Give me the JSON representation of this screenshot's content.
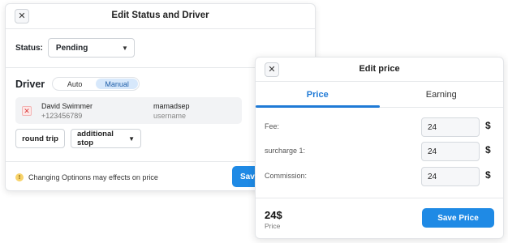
{
  "status_modal": {
    "title": "Edit Status and Driver",
    "close_icon": "close-icon",
    "status": {
      "label": "Status:",
      "value": "Pending"
    },
    "driver": {
      "title": "Driver",
      "modes": [
        "Auto",
        "Manual"
      ],
      "active_mode": "Manual",
      "card": {
        "name": "David Swimmer",
        "phone": "+123456789",
        "username": "mamadsep",
        "username_label": "username"
      }
    },
    "chips": {
      "round_trip": "round trip",
      "additional_stop": "additional stop"
    },
    "warning": "Changing Optinons may effects on price",
    "save_label": "Save"
  },
  "price_modal": {
    "title": "Edit price",
    "tabs": [
      "Price",
      "Earning"
    ],
    "active_tab": "Price",
    "fields": [
      {
        "label": "Fee:",
        "value": "24",
        "currency": "$"
      },
      {
        "label": "surcharge 1:",
        "value": "24",
        "currency": "$"
      },
      {
        "label": "Commission:",
        "value": "24",
        "currency": "$"
      }
    ],
    "total": {
      "value": "24$",
      "label": "Price"
    },
    "save_label": "Save Price"
  },
  "colors": {
    "accent": "#1f8ae5",
    "tab_active": "#1f7ad6",
    "toggle_active": "#d7e8fb",
    "warning": "#f8d36a"
  }
}
